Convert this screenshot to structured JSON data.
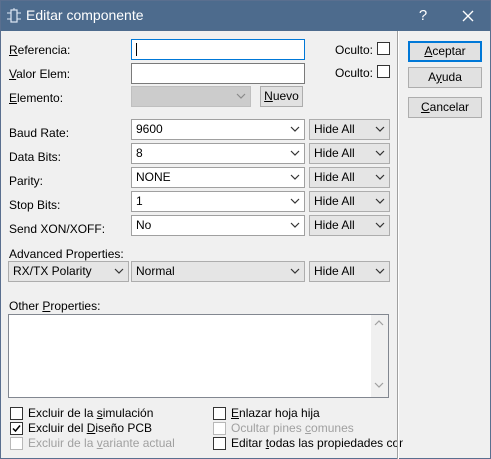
{
  "window": {
    "title": "Editar componente",
    "help": "?",
    "colors": {
      "titlebar": "#4d6b8d",
      "accent": "#0078d7"
    }
  },
  "fields": {
    "referencia": {
      "label_pre": "",
      "label_u": "R",
      "label_post": "eferencia:",
      "value": ""
    },
    "valor": {
      "label_pre": "",
      "label_u": "V",
      "label_post": "alor Elem:",
      "value": ""
    },
    "elemento": {
      "label_pre": "",
      "label_u": "E",
      "label_post": "lemento:",
      "value": ""
    },
    "oculto1": "Oculto:",
    "oculto2": "Oculto:",
    "nuevo_pre": "",
    "nuevo_u": "N",
    "nuevo_post": "uevo"
  },
  "buttons": {
    "aceptar_pre": "",
    "aceptar_u": "A",
    "aceptar_post": "ceptar",
    "ayuda_pre": "A",
    "ayuda_u": "y",
    "ayuda_post": "uda",
    "cancelar_pre": "",
    "cancelar_u": "C",
    "cancelar_post": "ancelar"
  },
  "properties": [
    {
      "label": "Baud Rate:",
      "value": "9600",
      "visibility": "Hide All"
    },
    {
      "label": "Data Bits:",
      "value": "8",
      "visibility": "Hide All"
    },
    {
      "label": "Parity:",
      "value": "NONE",
      "visibility": "Hide All"
    },
    {
      "label": "Stop Bits:",
      "value": "1",
      "visibility": "Hide All"
    },
    {
      "label": "Send XON/XOFF:",
      "value": "No",
      "visibility": "Hide All"
    }
  ],
  "advanced": {
    "label": "Advanced Properties:",
    "property": "RX/TX Polarity",
    "value": "Normal",
    "visibility": "Hide All"
  },
  "other": {
    "label_pre": "Other ",
    "label_u": "P",
    "label_post": "roperties:"
  },
  "checkboxes": {
    "excluir_sim": {
      "pre": "Excluir de la ",
      "u": "s",
      "post": "imulación",
      "checked": false,
      "enabled": true
    },
    "excluir_pcb": {
      "pre": "Excluir del ",
      "u": "D",
      "post": "iseño PCB",
      "checked": true,
      "enabled": true
    },
    "excluir_var": {
      "pre": "Excluir de la ",
      "u": "v",
      "post": "ariante actual",
      "checked": false,
      "enabled": false
    },
    "enlazar": {
      "pre": "",
      "u": "E",
      "post": "nlazar hoja hija",
      "checked": false,
      "enabled": true
    },
    "ocultar": {
      "pre": "Ocultar pines ",
      "u": "c",
      "post": "omunes",
      "checked": false,
      "enabled": false
    },
    "editar": {
      "pre": "Editar ",
      "u": "t",
      "post": "odas las propiedades como",
      "checked": false,
      "enabled": true
    }
  }
}
